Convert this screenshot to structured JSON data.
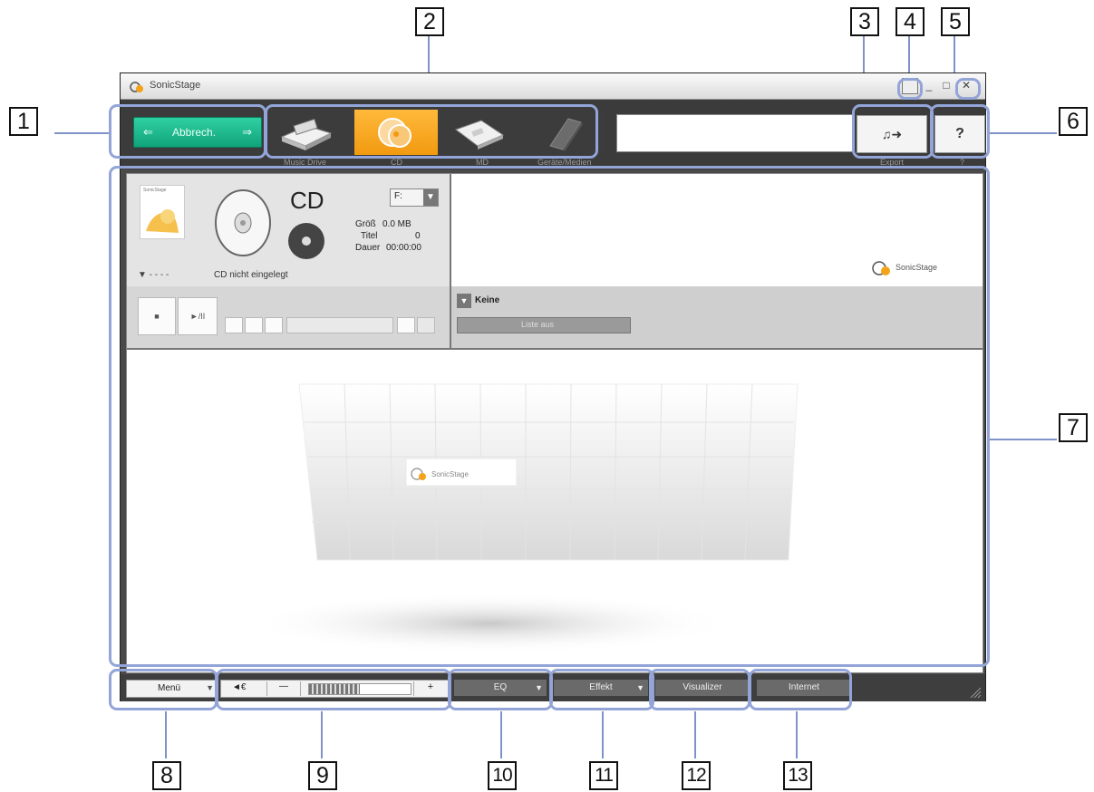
{
  "window": {
    "title": "SonicStage",
    "minimize": "_",
    "maximize": "□",
    "close": "✕"
  },
  "toolbar": {
    "switch_label": "Abbrech.",
    "switch_arrow_left": "⇐",
    "switch_arrow_right": "⇒",
    "modes": [
      {
        "label": "Music Drive",
        "icon": "music-drive-icon"
      },
      {
        "label": "CD",
        "icon": "cd-mode-icon"
      },
      {
        "label": "MD",
        "icon": "md-mode-icon"
      },
      {
        "label": "Geräte/Medien",
        "icon": "device-media-icon"
      }
    ],
    "export_label": "♫➜",
    "export_caption": "Export",
    "help_label": "?",
    "help_caption": "?"
  },
  "cd_panel": {
    "album_art_label": "SonicStage",
    "title": "CD",
    "menu_value": "F:",
    "size_label": "Größ",
    "size_value": "0.0 MB",
    "tracks_label": "Titel",
    "tracks_value": "0",
    "duration_label": "Dauer",
    "duration_value": "00:00:00",
    "dropdown_text": "▼ - - - -",
    "status": "CD nicht eingelegt",
    "stop_label": "■",
    "play_label": "►/II"
  },
  "right_panel": {
    "logo_text": "SonicStage",
    "list_label": "Keine",
    "dropdown_value": "Liste aus"
  },
  "visual_area": {
    "logo_text": "SonicStage"
  },
  "status_bar": {
    "menu_label": "Menü",
    "mute_label": "◄€",
    "vol_minus": "—",
    "vol_plus": "+",
    "volume_level": 0.5,
    "eq_label": "EQ",
    "effect_label": "Effekt",
    "visualizer_label": "Visualizer",
    "internet_label": "Internet"
  },
  "callouts": [
    "1",
    "2",
    "3",
    "4",
    "5",
    "6",
    "7",
    "8",
    "9",
    "10",
    "11",
    "12",
    "13"
  ],
  "colors": {
    "highlight": "#93a5d8",
    "switch_button": "#17b088",
    "active_mode": "#f5a623",
    "window_dark": "#3b3b3b"
  }
}
